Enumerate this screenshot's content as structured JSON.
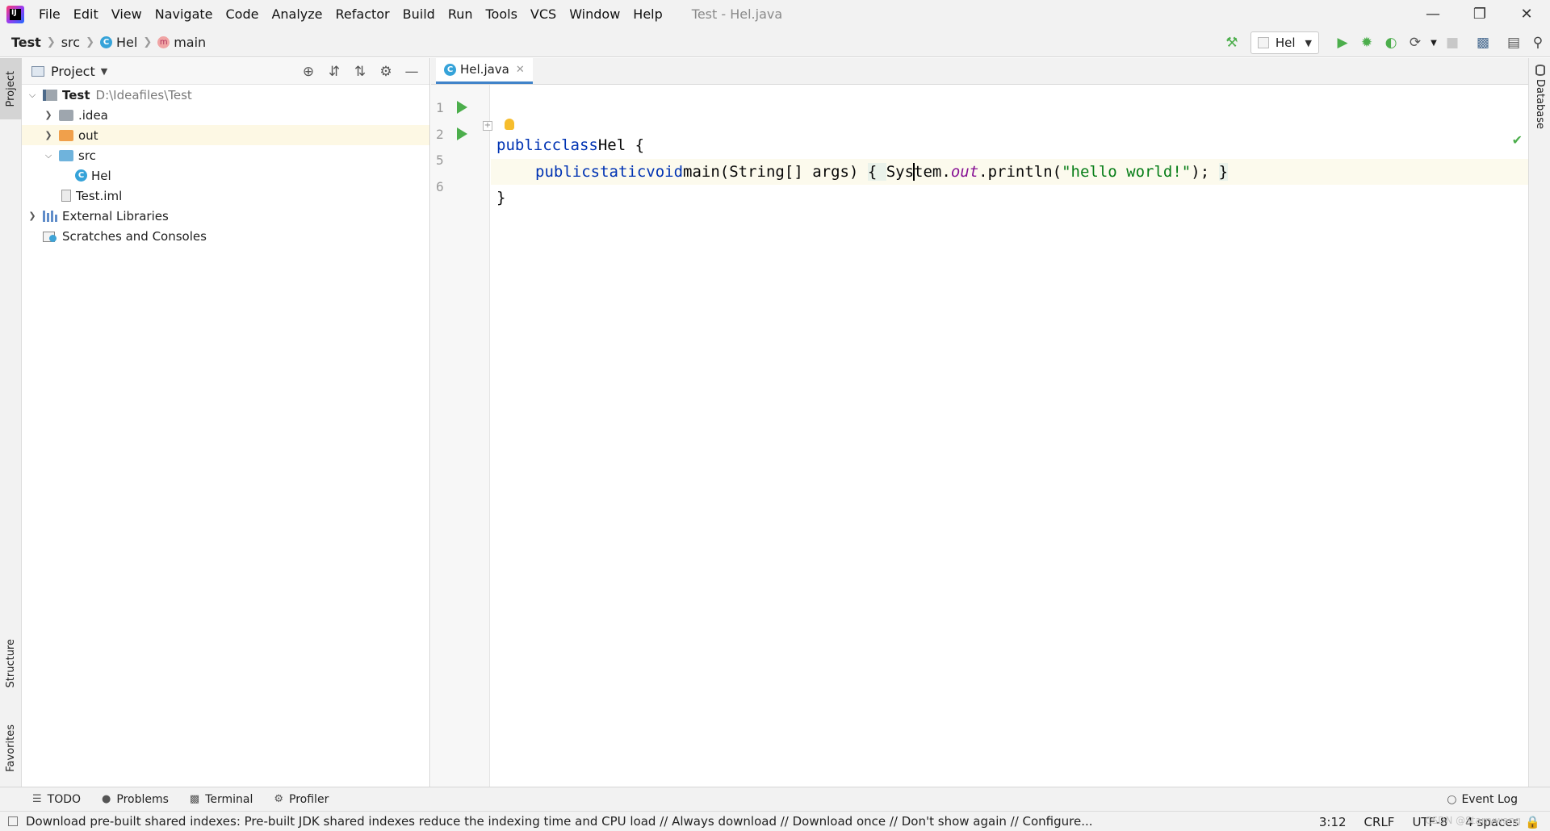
{
  "menubar": {
    "items": [
      "File",
      "Edit",
      "View",
      "Navigate",
      "Code",
      "Analyze",
      "Refactor",
      "Build",
      "Run",
      "Tools",
      "VCS",
      "Window",
      "Help"
    ],
    "window_title": "Test - Hel.java",
    "logo_text": "IJ"
  },
  "breadcrumb": [
    "Test",
    "src",
    "Hel",
    "main"
  ],
  "toolbar": {
    "run_config": "Hel"
  },
  "left_strip": {
    "project_label": "Project",
    "structure_label": "Structure",
    "favorites_label": "Favorites"
  },
  "project_panel": {
    "title": "Project",
    "tree": [
      {
        "name": "Test",
        "path": "D:\\Ideafiles\\Test"
      },
      {
        "name": ".idea"
      },
      {
        "name": "out"
      },
      {
        "name": "src"
      },
      {
        "name": "Hel"
      },
      {
        "name": "Test.iml"
      },
      {
        "name": "External Libraries"
      },
      {
        "name": "Scratches and Consoles"
      }
    ]
  },
  "editor": {
    "tab": "Hel.java",
    "line_numbers": [
      "1",
      "2",
      "5",
      "6"
    ],
    "code": {
      "l1_kw1": "public",
      "l1_kw2": "class",
      "l1_rest": "Hel {",
      "l2_kw1": "public",
      "l2_kw2": "static",
      "l2_kw3": "void",
      "l2_sig": "main(String[] args) ",
      "l2_open": "{ ",
      "l2_sys1": "Sys",
      "l2_sys2": "tem.",
      "l2_out": "out",
      "l2_call": ".println(",
      "l2_str": "\"hello world!\"",
      "l2_end": "); ",
      "l2_close": "}",
      "l5": "}"
    }
  },
  "right_strip": {
    "database_label": "Database"
  },
  "tool_windows": [
    "TODO",
    "Problems",
    "Terminal",
    "Profiler"
  ],
  "event_log": "Event Log",
  "statusbar": {
    "message": "Download pre-built shared indexes: Pre-built JDK shared indexes reduce the indexing time and CPU load // Always download // Download once // Don't show again // Configure...",
    "position": "3:12",
    "line_sep": "CRLF",
    "encoding": "UTF-8",
    "indent": "4 spaces",
    "watermark": "CSDN @Starrywang"
  },
  "colors": {
    "accent": "#4083c9",
    "run_green": "#4cae4c",
    "keyword": "#0033b3",
    "string": "#067d17",
    "field": "#871094"
  }
}
